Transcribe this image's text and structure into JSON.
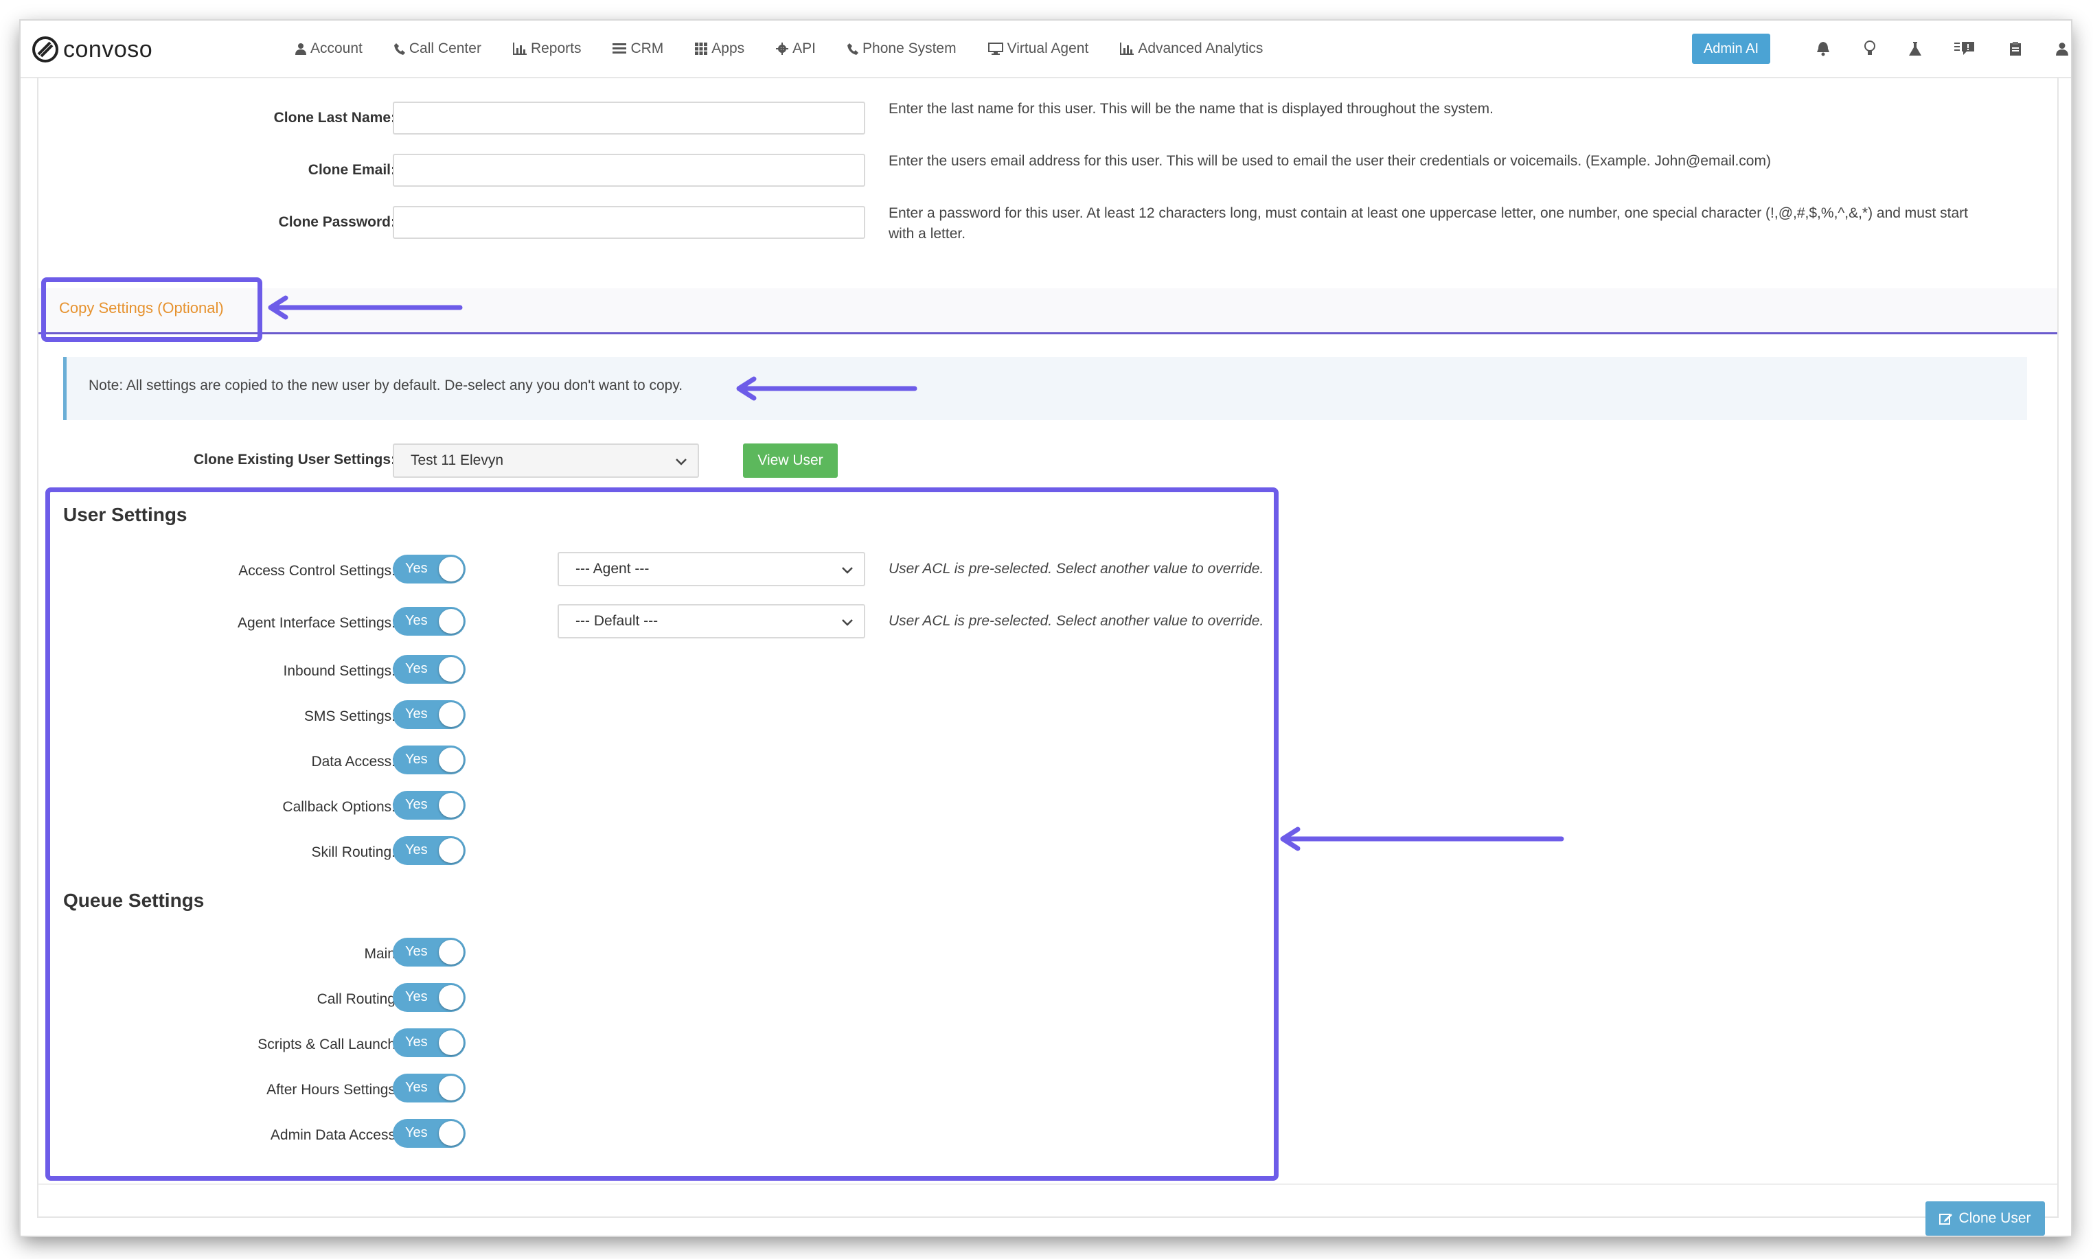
{
  "app": {
    "logo_text": "convoso",
    "colors": {
      "accent": "#6d5ce8",
      "toggle_on": "#5ba8d2",
      "tab_active": "#e6922e",
      "success": "#5cb85c"
    }
  },
  "nav": {
    "items": [
      {
        "label": "Account",
        "icon": "user-icon"
      },
      {
        "label": "Call Center",
        "icon": "phone-icon"
      },
      {
        "label": "Reports",
        "icon": "bar-chart-icon"
      },
      {
        "label": "CRM",
        "icon": "list-icon"
      },
      {
        "label": "Apps",
        "icon": "grid-icon"
      },
      {
        "label": "API",
        "icon": "gear-icon"
      },
      {
        "label": "Phone System",
        "icon": "phone-icon"
      },
      {
        "label": "Virtual Agent",
        "icon": "monitor-icon"
      },
      {
        "label": "Advanced Analytics",
        "icon": "bar-chart-icon"
      }
    ],
    "admin_ai": "Admin AI",
    "right_icons": [
      "bell-icon",
      "lightbulb-icon",
      "flask-icon",
      "message-icon",
      "clipboard-icon",
      "user-icon"
    ]
  },
  "clone_fields": {
    "last_name": {
      "label": "Clone Last Name:",
      "value": "",
      "help": "Enter the last name for this user. This will be the name that is displayed throughout the system."
    },
    "email": {
      "label": "Clone Email:",
      "value": "",
      "help": "Enter the users email address for this user. This will be used to email the user their credentials or voicemails. (Example. John@email.com)"
    },
    "password": {
      "label": "Clone Password:",
      "value": "",
      "help_line1": "Enter a password for this user. At least 12 characters long, must contain at least one uppercase letter, one number, one special character (!,@,#,$,%,^,&,*) and must start",
      "help_line2": "with a letter."
    }
  },
  "copy_settings": {
    "tab_label": "Copy Settings (Optional)",
    "note": "Note: All settings are copied to the new user by default. De-select any you don't want to copy.",
    "clone_existing_label": "Clone Existing User Settings:",
    "clone_existing_value": "Test 11 Elevyn",
    "view_user_button": "View User"
  },
  "user_settings": {
    "title": "User Settings",
    "acl_help": "User ACL is pre-selected. Select another value to override.",
    "items": [
      {
        "label": "Access Control Settings:",
        "toggle": "Yes",
        "select": "--- Agent ---"
      },
      {
        "label": "Agent Interface Settings:",
        "toggle": "Yes",
        "select": "--- Default ---"
      },
      {
        "label": "Inbound Settings:",
        "toggle": "Yes"
      },
      {
        "label": "SMS Settings:",
        "toggle": "Yes"
      },
      {
        "label": "Data Access:",
        "toggle": "Yes"
      },
      {
        "label": "Callback Options:",
        "toggle": "Yes"
      },
      {
        "label": "Skill Routing:",
        "toggle": "Yes"
      }
    ]
  },
  "queue_settings": {
    "title": "Queue Settings",
    "items": [
      {
        "label": "Main",
        "toggle": "Yes"
      },
      {
        "label": "Call Routing",
        "toggle": "Yes"
      },
      {
        "label": "Scripts & Call Launch",
        "toggle": "Yes"
      },
      {
        "label": "After Hours Settings",
        "toggle": "Yes"
      },
      {
        "label": "Admin Data Access",
        "toggle": "Yes"
      }
    ]
  },
  "footer": {
    "clone_user_button": "Clone User"
  }
}
